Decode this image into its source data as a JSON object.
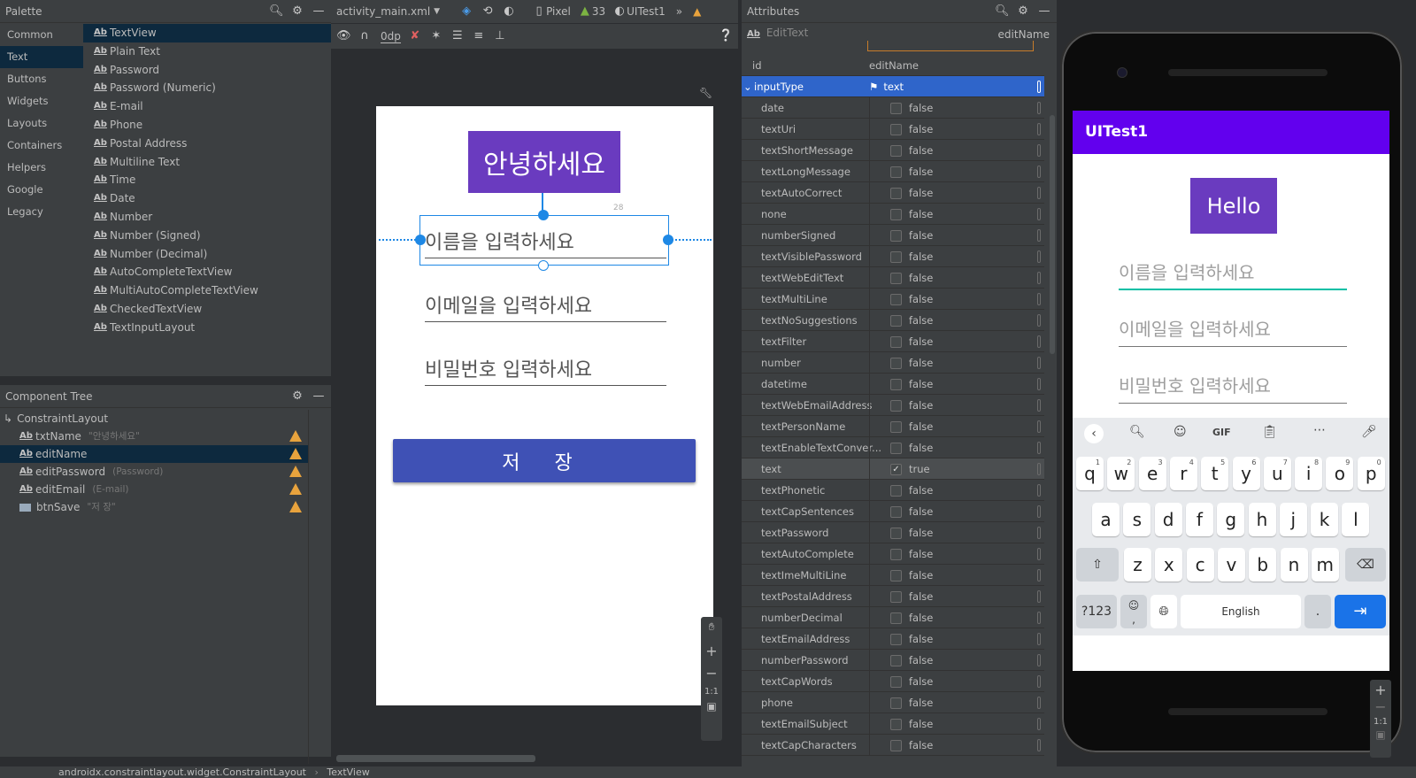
{
  "palette": {
    "title": "Palette",
    "categories": [
      "Common",
      "Text",
      "Buttons",
      "Widgets",
      "Layouts",
      "Containers",
      "Helpers",
      "Google",
      "Legacy"
    ],
    "selected_category": "Text",
    "items": [
      "TextView",
      "Plain Text",
      "Password",
      "Password (Numeric)",
      "E-mail",
      "Phone",
      "Postal Address",
      "Multiline Text",
      "Time",
      "Date",
      "Number",
      "Number (Signed)",
      "Number (Decimal)",
      "AutoCompleteTextView",
      "MultiAutoCompleteTextView",
      "CheckedTextView",
      "TextInputLayout"
    ],
    "selected_item": "TextView"
  },
  "component_tree": {
    "title": "Component Tree",
    "root": "ConstraintLayout",
    "nodes": [
      {
        "name": "txtName",
        "sub": "\"안녕하세요\""
      },
      {
        "name": "editName",
        "sub": ""
      },
      {
        "name": "editPassword",
        "sub": "(Password)"
      },
      {
        "name": "editEmail",
        "sub": "(E-mail)"
      },
      {
        "name": "btnSave",
        "sub": "\"저 장\""
      }
    ]
  },
  "toolbar": {
    "file": "activity_main.xml",
    "device": "Pixel",
    "api": "33",
    "theme": "UITest1",
    "margin": "0dp"
  },
  "design": {
    "hello_text": "안녕하세요",
    "edit_name_hint": "이름을 입력하세요",
    "edit_email_hint": "이메일을 입력하세요",
    "edit_password_hint": "비밀번호 입력하세요",
    "save_button": "저 장",
    "margin_label": "28"
  },
  "attributes": {
    "title": "Attributes",
    "widget_type": "EditText",
    "widget_id": "editName",
    "id_label": "id",
    "id_value": "editName",
    "input_type_label": "inputType",
    "input_type_value": "text",
    "flags": [
      {
        "name": "date",
        "value": "false"
      },
      {
        "name": "textUri",
        "value": "false"
      },
      {
        "name": "textShortMessage",
        "value": "false"
      },
      {
        "name": "textLongMessage",
        "value": "false"
      },
      {
        "name": "textAutoCorrect",
        "value": "false"
      },
      {
        "name": "none",
        "value": "false"
      },
      {
        "name": "numberSigned",
        "value": "false"
      },
      {
        "name": "textVisiblePassword",
        "value": "false"
      },
      {
        "name": "textWebEditText",
        "value": "false"
      },
      {
        "name": "textMultiLine",
        "value": "false"
      },
      {
        "name": "textNoSuggestions",
        "value": "false"
      },
      {
        "name": "textFilter",
        "value": "false"
      },
      {
        "name": "number",
        "value": "false"
      },
      {
        "name": "datetime",
        "value": "false"
      },
      {
        "name": "textWebEmailAddress",
        "value": "false"
      },
      {
        "name": "textPersonName",
        "value": "false"
      },
      {
        "name": "textEnableTextConver...",
        "value": "false"
      },
      {
        "name": "text",
        "value": "true"
      },
      {
        "name": "textPhonetic",
        "value": "false"
      },
      {
        "name": "textCapSentences",
        "value": "false"
      },
      {
        "name": "textPassword",
        "value": "false"
      },
      {
        "name": "textAutoComplete",
        "value": "false"
      },
      {
        "name": "textImeMultiLine",
        "value": "false"
      },
      {
        "name": "textPostalAddress",
        "value": "false"
      },
      {
        "name": "numberDecimal",
        "value": "false"
      },
      {
        "name": "textEmailAddress",
        "value": "false"
      },
      {
        "name": "numberPassword",
        "value": "false"
      },
      {
        "name": "textCapWords",
        "value": "false"
      },
      {
        "name": "phone",
        "value": "false"
      },
      {
        "name": "textEmailSubject",
        "value": "false"
      },
      {
        "name": "textCapCharacters",
        "value": "false"
      }
    ]
  },
  "emulator": {
    "app_title": "UITest1",
    "hello_text": "Hello",
    "name_hint": "이름을 입력하세요",
    "email_hint": "이메일을 입력하세요",
    "password_hint": "비밀번호 입력하세요",
    "keyboard": {
      "row1": [
        "q",
        "w",
        "e",
        "r",
        "t",
        "y",
        "u",
        "i",
        "o",
        "p"
      ],
      "row1_nums": [
        "1",
        "2",
        "3",
        "4",
        "5",
        "6",
        "7",
        "8",
        "9",
        "0"
      ],
      "row2": [
        "a",
        "s",
        "d",
        "f",
        "g",
        "h",
        "j",
        "k",
        "l"
      ],
      "row3": [
        "z",
        "x",
        "c",
        "v",
        "b",
        "n",
        "m"
      ],
      "sym_key": "?123",
      "space_label": "English",
      "period": ".",
      "comma": ",",
      "gif": "GIF"
    },
    "zoom_reset": "1:1"
  },
  "statusbar": {
    "path1": "androidx.constraintlayout.widget.ConstraintLayout",
    "path2": "TextView"
  },
  "colors": {
    "accent": "#6200ee",
    "button": "#3f51b5",
    "hello_bg": "#6a3bbf",
    "selection": "#0d293e",
    "warning": "#e8a33d"
  }
}
